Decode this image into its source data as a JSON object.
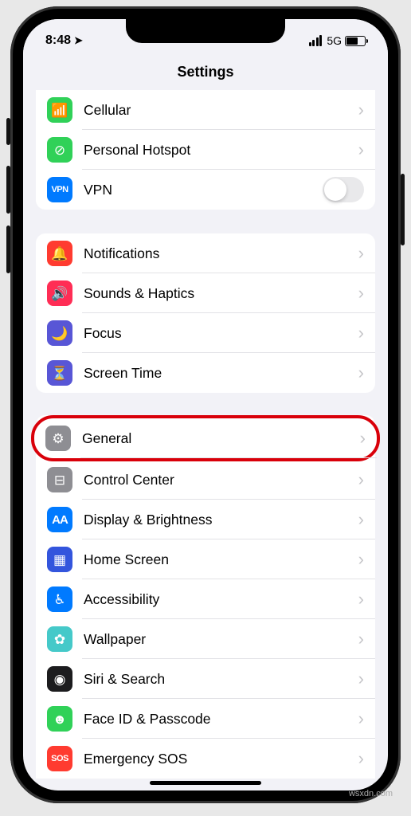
{
  "status": {
    "time": "8:48",
    "network": "5G"
  },
  "header": {
    "title": "Settings"
  },
  "groups": [
    {
      "id": "connectivity",
      "firstCut": true,
      "items": [
        {
          "label": "Cellular",
          "icon": "antenna",
          "bg": "#30d158",
          "glyph": "📶",
          "action": "chevron"
        },
        {
          "label": "Personal Hotspot",
          "icon": "link",
          "bg": "#30d158",
          "glyph": "⊘",
          "action": "chevron"
        },
        {
          "label": "VPN",
          "icon": "vpn",
          "bg": "#007aff",
          "glyph": "VPN",
          "action": "toggle"
        }
      ]
    },
    {
      "id": "notifications",
      "items": [
        {
          "label": "Notifications",
          "icon": "bell",
          "bg": "#ff3b30",
          "glyph": "🔔",
          "action": "chevron"
        },
        {
          "label": "Sounds & Haptics",
          "icon": "speaker",
          "bg": "#ff2d55",
          "glyph": "🔊",
          "action": "chevron"
        },
        {
          "label": "Focus",
          "icon": "moon",
          "bg": "#5856d6",
          "glyph": "🌙",
          "action": "chevron"
        },
        {
          "label": "Screen Time",
          "icon": "hourglass",
          "bg": "#5856d6",
          "glyph": "⏳",
          "action": "chevron"
        }
      ]
    },
    {
      "id": "general",
      "lastCut": true,
      "items": [
        {
          "label": "General",
          "icon": "gear",
          "bg": "#8e8e93",
          "glyph": "⚙",
          "action": "chevron",
          "highlighted": true
        },
        {
          "label": "Control Center",
          "icon": "switches",
          "bg": "#8e8e93",
          "glyph": "⊟",
          "action": "chevron"
        },
        {
          "label": "Display & Brightness",
          "icon": "text-size",
          "bg": "#007aff",
          "glyph": "AA",
          "action": "chevron"
        },
        {
          "label": "Home Screen",
          "icon": "grid",
          "bg": "#3355dd",
          "glyph": "▦",
          "action": "chevron"
        },
        {
          "label": "Accessibility",
          "icon": "accessibility",
          "bg": "#007aff",
          "glyph": "♿︎",
          "action": "chevron"
        },
        {
          "label": "Wallpaper",
          "icon": "flower",
          "bg": "#45c9c9",
          "glyph": "✿",
          "action": "chevron"
        },
        {
          "label": "Siri & Search",
          "icon": "siri",
          "bg": "#1c1c1e",
          "glyph": "◉",
          "action": "chevron"
        },
        {
          "label": "Face ID & Passcode",
          "icon": "faceid",
          "bg": "#30d158",
          "glyph": "☻",
          "action": "chevron"
        },
        {
          "label": "Emergency SOS",
          "icon": "sos",
          "bg": "#ff3b30",
          "glyph": "SOS",
          "action": "chevron"
        }
      ]
    }
  ],
  "watermark": "wsxdn.com"
}
